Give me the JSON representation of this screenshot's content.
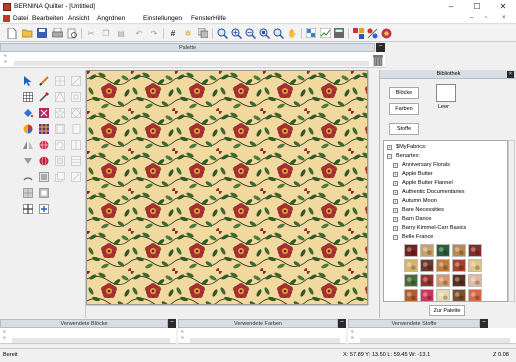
{
  "window": {
    "title": "BERNINA Quilter - [Untitled]",
    "minimize": "–",
    "maximize": "☐",
    "close": "✕"
  },
  "menu": {
    "items": [
      "Datei",
      "Bearbeiten",
      "Ansicht",
      "Angrdnen",
      "Einstellungen",
      "Fenster",
      "Hilfe"
    ],
    "mdi": {
      "minimize": "–",
      "restore": "▫",
      "close": "×"
    }
  },
  "toolbar": {
    "icons": [
      "new-file-icon",
      "open-folder-icon",
      "save-icon",
      "print-icon",
      "print-preview-icon",
      "cut-icon",
      "copy-icon",
      "paste-icon",
      "undo-icon",
      "redo-icon",
      "grid-icon",
      "star-icon",
      "layers-icon",
      "zoom-out-icon",
      "zoom-in-icon",
      "zoom-fit-icon",
      "zoom-window-icon",
      "zoom-page-icon",
      "pan-hand-icon",
      "quilt-layout-icon",
      "chart-icon",
      "calculator-icon",
      "fabric-tool-icon",
      "pattern-tool-icon",
      "color-tool-icon"
    ]
  },
  "palette": {
    "header": "Palette",
    "min_label": "–",
    "chev": "«\n»"
  },
  "library": {
    "header": "Bibliothek",
    "close": "×",
    "buttons": {
      "blocks": "Blöcke",
      "fabrics": "Farben",
      "materials": "Stoffe",
      "empty_label": "Leer",
      "add_to_palette": "Zur Palette"
    },
    "tree": [
      {
        "label": "$MyFabrics:",
        "indent": 0,
        "expander": "+"
      },
      {
        "label": "Benartex:",
        "indent": 0,
        "expander": "−"
      },
      {
        "label": "Anniversary Florals",
        "indent": 1,
        "expander": "+"
      },
      {
        "label": "Apple Butter",
        "indent": 1,
        "expander": "+"
      },
      {
        "label": "Apple Butter Flannel",
        "indent": 1,
        "expander": "+"
      },
      {
        "label": "Authentic Documentaries",
        "indent": 1,
        "expander": "+"
      },
      {
        "label": "Autumn Moon",
        "indent": 1,
        "expander": "+"
      },
      {
        "label": "Bare Necessities",
        "indent": 1,
        "expander": "+"
      },
      {
        "label": "Barn Dance",
        "indent": 1,
        "expander": "+"
      },
      {
        "label": "Barry Kimmel-Carr Basics",
        "indent": 1,
        "expander": "+"
      },
      {
        "label": "Belle France",
        "indent": 1,
        "expander": "−"
      }
    ],
    "swatch_colors": [
      "#7a1f1f",
      "#c9a26b",
      "#2f5e3a",
      "#b88a4d",
      "#8a2b2b",
      "#d8b46a",
      "#6e3b2a",
      "#c27a3d",
      "#a5402a",
      "#e1c48a",
      "#4c6b3a",
      "#9a3030",
      "#d49a6a",
      "#5a3020",
      "#e5b8a0",
      "#b06030",
      "#c9385a",
      "#e8d8b0",
      "#7a5030",
      "#d46a4a"
    ]
  },
  "bottom_panels": {
    "used_blocks": "Verwendete Blöcke",
    "used_colors": "Verwendete Farben",
    "used_fabrics": "Verwendete Stoffe",
    "min_label": "–",
    "chev": "«\n»"
  },
  "status": {
    "ready": "Bereit",
    "coords": "X:  57.89 Y:  13.50 L:  59.45 W:  -13.1",
    "zoom": "Z 0.08"
  },
  "colors": {
    "fabric_bg": "#f2d9a0",
    "leaf": "#2e5a2a",
    "flower": "#8b2222"
  }
}
